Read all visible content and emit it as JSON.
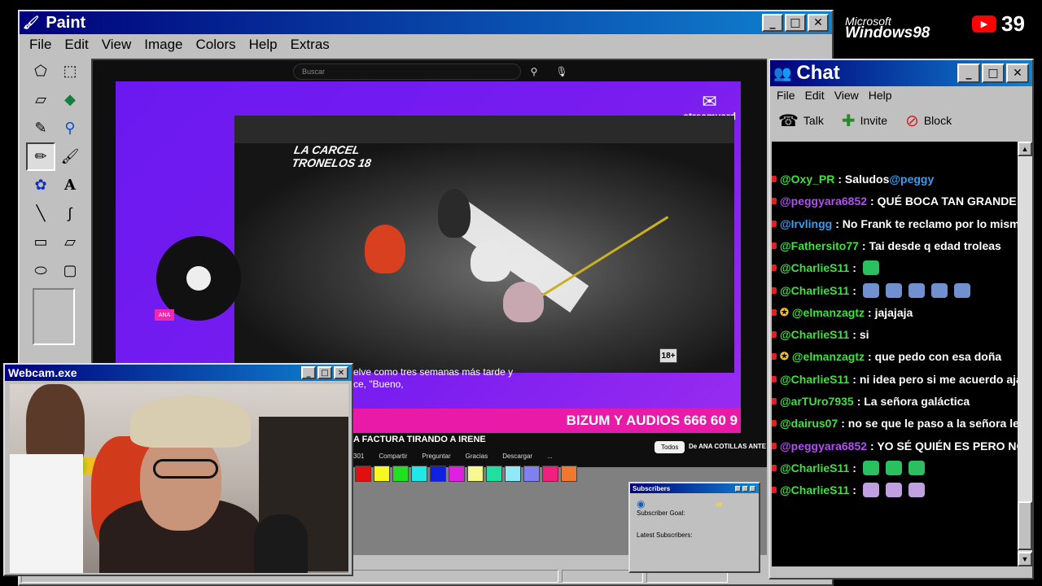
{
  "paint": {
    "title": "Paint",
    "menu": [
      "File",
      "Edit",
      "View",
      "Image",
      "Colors",
      "Help",
      "Extras"
    ],
    "window_buttons": [
      "_",
      "□",
      "✕"
    ],
    "tools": [
      "free-select-icon",
      "rect-select-icon",
      "eraser-icon",
      "fill-icon",
      "color-picker-icon",
      "magnifier-icon",
      "pencil-icon",
      "brush-icon",
      "airbrush-icon",
      "text-icon",
      "line-icon",
      "curve-icon",
      "rectangle-icon",
      "polygon-icon",
      "ellipse-icon",
      "rounded-rect-icon"
    ],
    "palette": [
      "#e01010",
      "#f8f820",
      "#20e020",
      "#20e8e8",
      "#1020e0",
      "#e020e0",
      "#f8f890",
      "#20e0a0",
      "#90e8f8",
      "#8080f0",
      "#f02080",
      "#f07830"
    ]
  },
  "youtube": {
    "search_placeholder": "Buscar",
    "overlay_logo": "LA CARCEL\nTRONELOS 18",
    "age_badge": "18+",
    "streamyard": "streamyard",
    "name_tag": "ANA",
    "banner": "BIZUM Y AUDIOS 666 60 9",
    "subtitle": "elve como tres semanas más tarde y\nce, \"Bueno,",
    "video_title": "A FACTURA TIRANDO A IRENE",
    "actions": [
      "301",
      "Compartir",
      "Preguntar",
      "Gracias",
      "Descargar",
      "..."
    ],
    "filter_chip": "Todos",
    "channel_chip": "De ANA COTILLAS ANTE TOD"
  },
  "subscribers": {
    "title": "Subscribers",
    "goal_label": "Subscriber Goal:",
    "latest_label": "Latest Subscribers:"
  },
  "webcam": {
    "title": "Webcam.exe",
    "window_buttons": [
      "_",
      "□",
      "✕"
    ]
  },
  "branding": {
    "microsoft": "Microsoft",
    "windows98": "Windows98",
    "yt_count": "39"
  },
  "chat": {
    "title": "Chat",
    "menu": [
      "File",
      "Edit",
      "View",
      "Help"
    ],
    "window_buttons": [
      "_",
      "□",
      "✕"
    ],
    "tools": [
      {
        "label": "Talk",
        "icon": "phone-icon"
      },
      {
        "label": "Invite",
        "icon": "invite-icon"
      },
      {
        "label": "Block",
        "icon": "block-icon"
      }
    ],
    "messages": [
      {
        "user": "@Oxy_PR",
        "color": "#40e040",
        "text": ": Saludos ",
        "mention": "@peggy",
        "mod": false
      },
      {
        "user": "@peggyara6852",
        "color": "#b050f0",
        "text": ": QUÉ BOCA TAN GRANDE TIEN",
        "mod": false
      },
      {
        "user": "@Irvlingg",
        "color": "#3c9cf0",
        "text": ": No Frank te reclamo por lo mismo que",
        "mod": false
      },
      {
        "user": "@Fathersito77",
        "color": "#40e040",
        "text": ": Tai desde q edad troleas",
        "mod": false
      },
      {
        "user": "@CharlieS11",
        "color": "#40e040",
        "text": " :",
        "emotes": 1,
        "mod": false
      },
      {
        "user": "@CharlieS11",
        "color": "#40e040",
        "text": " :",
        "emotes": 5,
        "mod": false
      },
      {
        "user": "@elmanzagtz",
        "color": "#40e040",
        "text": ": jajajaja",
        "mod": true
      },
      {
        "user": "@CharlieS11",
        "color": "#40e040",
        "text": " : si",
        "mod": false
      },
      {
        "user": "@elmanzagtz",
        "color": "#40e040",
        "text": ": que pedo con esa doña",
        "mod": true
      },
      {
        "user": "@CharlieS11",
        "color": "#40e040",
        "text": " : ni idea pero si me acuerdo ajajaja",
        "mod": false
      },
      {
        "user": "@arTUro7935",
        "color": "#40e040",
        "text": ": La señora galáctica",
        "mod": false
      },
      {
        "user": "@dairus07",
        "color": "#40e040",
        "text": ": no se que le paso a la señora le perd",
        "mod": false
      },
      {
        "user": "@peggyara6852",
        "color": "#b050f0",
        "text": ": YO SÉ QUIÉN ES PERO NO REC",
        "mod": false
      },
      {
        "user": "@CharlieS11",
        "color": "#40e040",
        "text": " :",
        "emotes": 3,
        "mod": false
      },
      {
        "user": "@CharlieS11",
        "color": "#40e040",
        "text": " :",
        "emotes": 3,
        "mod": false
      }
    ]
  }
}
